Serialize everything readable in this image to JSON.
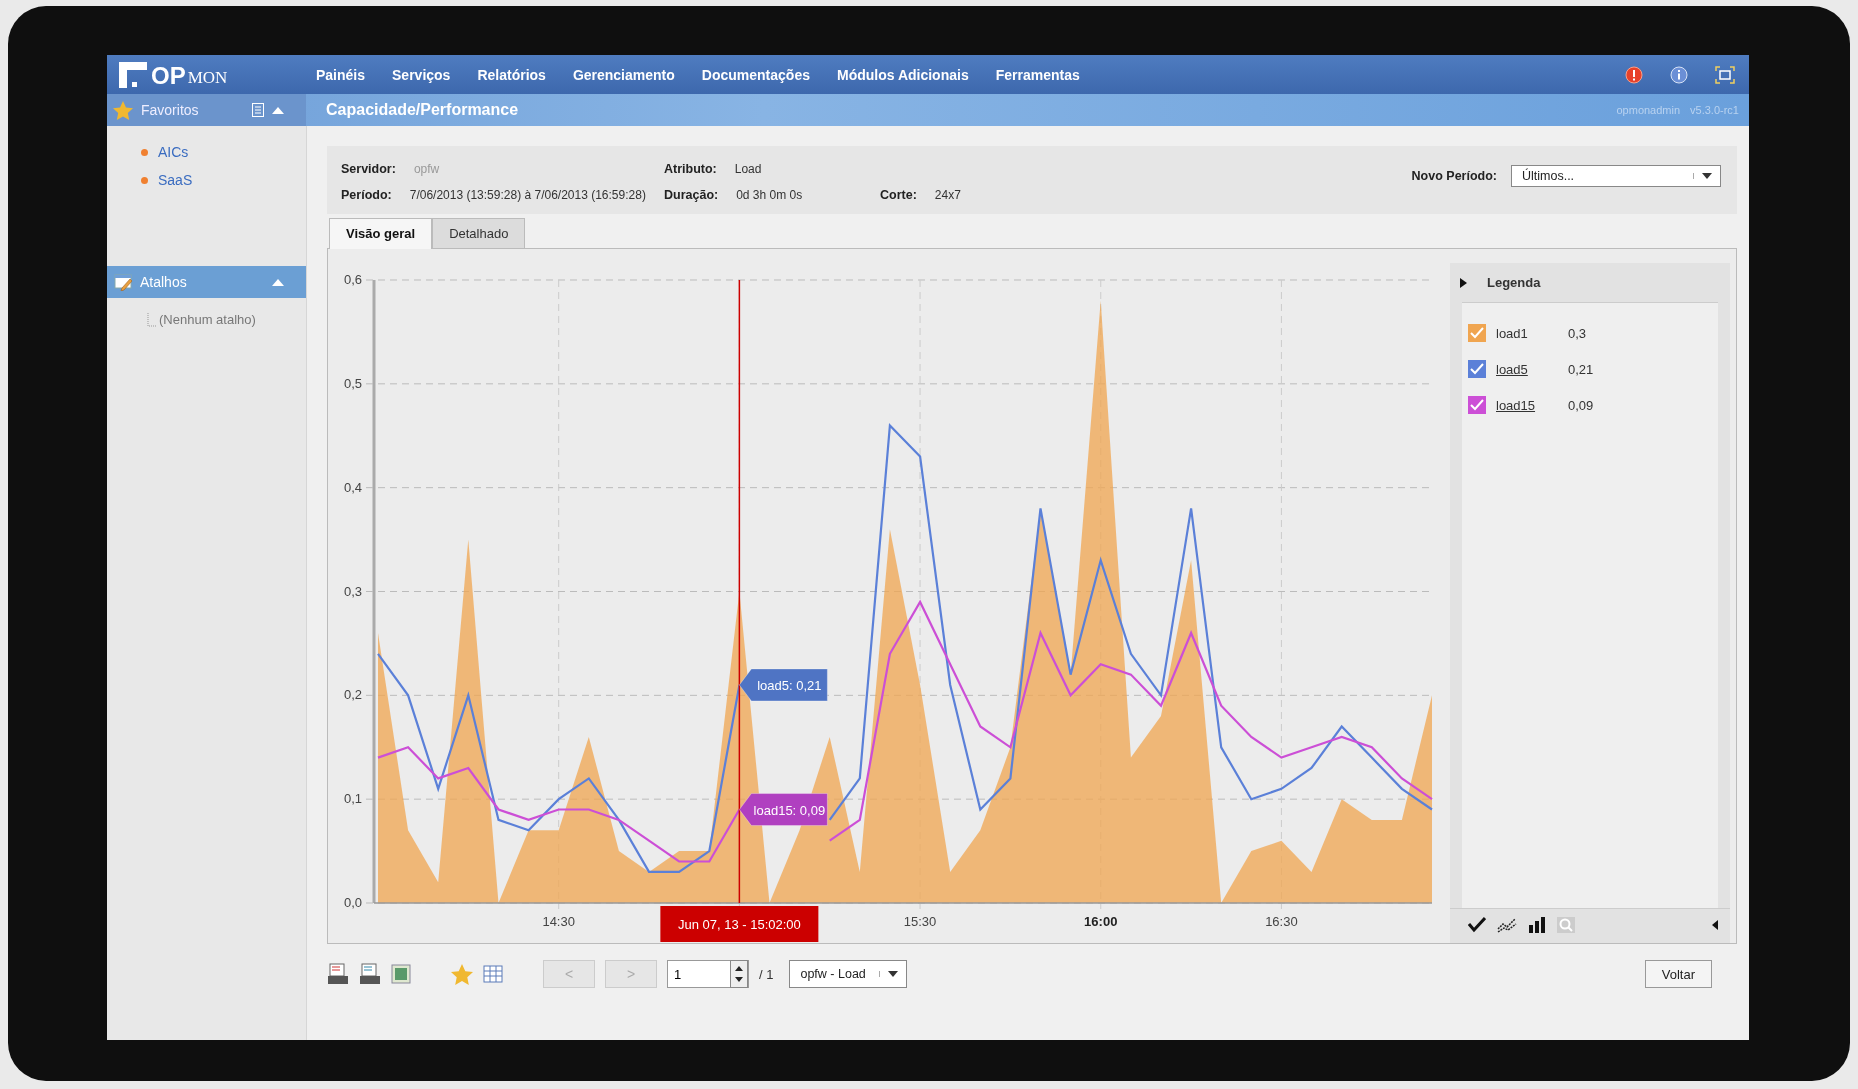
{
  "logo": {
    "brand": "OP",
    "suffix": "MON"
  },
  "menu": [
    "Painéis",
    "Serviços",
    "Relatórios",
    "Gerenciamento",
    "Documentações",
    "Módulos Adicionais",
    "Ferramentas"
  ],
  "sidebar": {
    "favorites": {
      "title": "Favoritos",
      "items": [
        "AICs",
        "SaaS"
      ]
    },
    "shortcuts": {
      "title": "Atalhos",
      "items": [
        "(Nenhum atalho)"
      ]
    }
  },
  "page": {
    "title": "Capacidade/Performance",
    "user": "opmonadmin",
    "version": "v5.3.0-rc1"
  },
  "info": {
    "rows": [
      [
        {
          "label": "Servidor:",
          "value": "opfw"
        },
        {
          "label": "Atributo:",
          "value": "Load"
        }
      ],
      [
        {
          "label": "Período:",
          "value": "7/06/2013 (13:59:28) à 7/06/2013 (16:59:28)"
        },
        {
          "label": "Duração:",
          "value": "0d 3h 0m 0s"
        },
        {
          "label": "Corte:",
          "value": "24x7"
        }
      ]
    ],
    "new_period": {
      "label": "Novo Período:",
      "value": "Últimos..."
    }
  },
  "tabs": [
    {
      "label": "Visão geral",
      "selected": true
    },
    {
      "label": "Detalhado",
      "selected": false
    }
  ],
  "chart": {
    "chart_data": {
      "type": "line",
      "grid": true,
      "ylim": [
        0,
        0.6
      ],
      "categories": [
        null,
        null,
        null,
        null,
        null,
        null,
        "14:30",
        null,
        null,
        null,
        null,
        null,
        null,
        null,
        null,
        null,
        null,
        null,
        "15:30",
        null,
        null,
        null,
        null,
        null,
        "16:00",
        null,
        null,
        null,
        null,
        null,
        "16:30",
        null,
        null,
        null,
        null,
        null
      ],
      "yticks": [
        {
          "value": 0,
          "label": "0,0"
        },
        {
          "value": 0.1,
          "label": "0,1"
        },
        {
          "value": 0.2,
          "label": "0,2"
        },
        {
          "value": 0.3,
          "label": "0,3"
        },
        {
          "value": 0.4,
          "label": "0,4"
        },
        {
          "value": 0.5,
          "label": "0,5"
        },
        {
          "value": 0.6,
          "label": "0,6"
        }
      ],
      "series": [
        {
          "name": "load1",
          "color": "#f0a550",
          "type": "area",
          "values": [
            0.26,
            0.07,
            0.02,
            0.35,
            0.0,
            0.07,
            0.07,
            0.16,
            0.05,
            0.03,
            0.05,
            0.05,
            0.3,
            0.0,
            0.07,
            0.16,
            0.03,
            0.36,
            0.21,
            0.03,
            0.07,
            0.15,
            0.38,
            0.22,
            0.58,
            0.14,
            0.18,
            0.33,
            0.0,
            0.05,
            0.06,
            0.03,
            0.1,
            0.08,
            0.08,
            0.2
          ]
        },
        {
          "name": "load5",
          "color": "#5b80d8",
          "values": [
            0.24,
            0.2,
            0.11,
            0.2,
            0.08,
            0.07,
            0.1,
            0.12,
            0.08,
            0.03,
            0.03,
            0.05,
            0.21,
            null,
            null,
            0.08,
            0.12,
            0.46,
            0.43,
            0.21,
            0.09,
            0.12,
            0.38,
            0.22,
            0.33,
            0.24,
            0.2,
            0.38,
            0.15,
            0.1,
            0.11,
            0.13,
            0.17,
            0.14,
            0.11,
            0.09
          ]
        },
        {
          "name": "load15",
          "color": "#cc4fd6",
          "values": [
            0.14,
            0.15,
            0.12,
            0.13,
            0.09,
            0.08,
            0.09,
            0.09,
            0.08,
            0.06,
            0.04,
            0.04,
            0.09,
            null,
            null,
            0.06,
            0.08,
            0.24,
            0.29,
            0.23,
            0.17,
            0.15,
            0.26,
            0.2,
            0.23,
            0.22,
            0.19,
            0.26,
            0.19,
            0.16,
            0.14,
            0.15,
            0.16,
            0.15,
            0.12,
            0.1
          ]
        }
      ],
      "annotations": [
        "Jun 07, 13 - 15:02:00",
        "load5: 0,21",
        "load15: 0,09"
      ]
    }
  },
  "legend": {
    "title": "Legenda",
    "items": [
      {
        "value": "0,3",
        "checked": true,
        "underlined": false
      },
      {
        "value": "0,21",
        "checked": true,
        "underlined": true
      },
      {
        "value": "0,09",
        "checked": true,
        "underlined": true
      }
    ]
  },
  "toolbar": {
    "prev": "<",
    "next": ">",
    "page": "1",
    "page_total": "/ 1",
    "chart_select": "opfw - Load",
    "back": "Voltar"
  }
}
